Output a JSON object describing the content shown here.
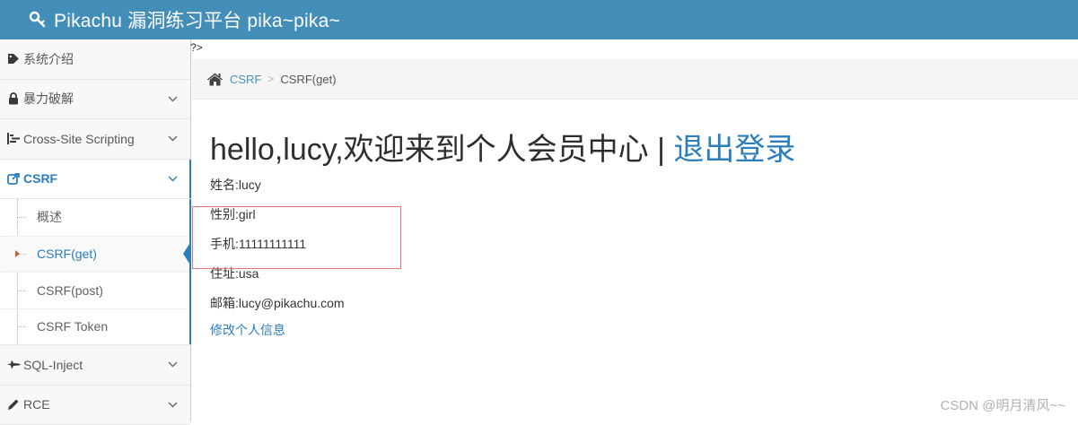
{
  "app": {
    "title": "Pikachu 漏洞练习平台 pika~pika~"
  },
  "sidebar": {
    "items": [
      {
        "label": "系统介绍",
        "icon": "tag-icon"
      },
      {
        "label": "暴力破解",
        "icon": "lock-icon"
      },
      {
        "label": "Cross-Site Scripting",
        "icon": "list-icon"
      },
      {
        "label": "CSRF",
        "icon": "share-icon"
      },
      {
        "label": "SQL-Inject",
        "icon": "fighter-jet-icon"
      },
      {
        "label": "RCE",
        "icon": "pencil-icon"
      }
    ],
    "csrf_submenu": [
      {
        "label": "概述"
      },
      {
        "label": "CSRF(get)"
      },
      {
        "label": "CSRF(post)"
      },
      {
        "label": "CSRF Token"
      }
    ]
  },
  "main": {
    "leak_text": "?>",
    "breadcrumb": {
      "parent": "CSRF",
      "separator": ">",
      "current": "CSRF(get)"
    },
    "welcome": {
      "text": "hello,lucy,欢迎来到个人会员中心 | ",
      "logout": "退出登录"
    },
    "info": [
      "姓名:lucy",
      "性别:girl",
      "手机:11111111111",
      "住址:usa",
      "邮箱:lucy@pikachu.com"
    ],
    "edit_link": "修改个人信息"
  },
  "watermark": "CSDN @明月清风~~",
  "colors": {
    "header_bg": "#438eb9",
    "accent": "#2b7dbc",
    "highlight_box": "#e0757b"
  }
}
